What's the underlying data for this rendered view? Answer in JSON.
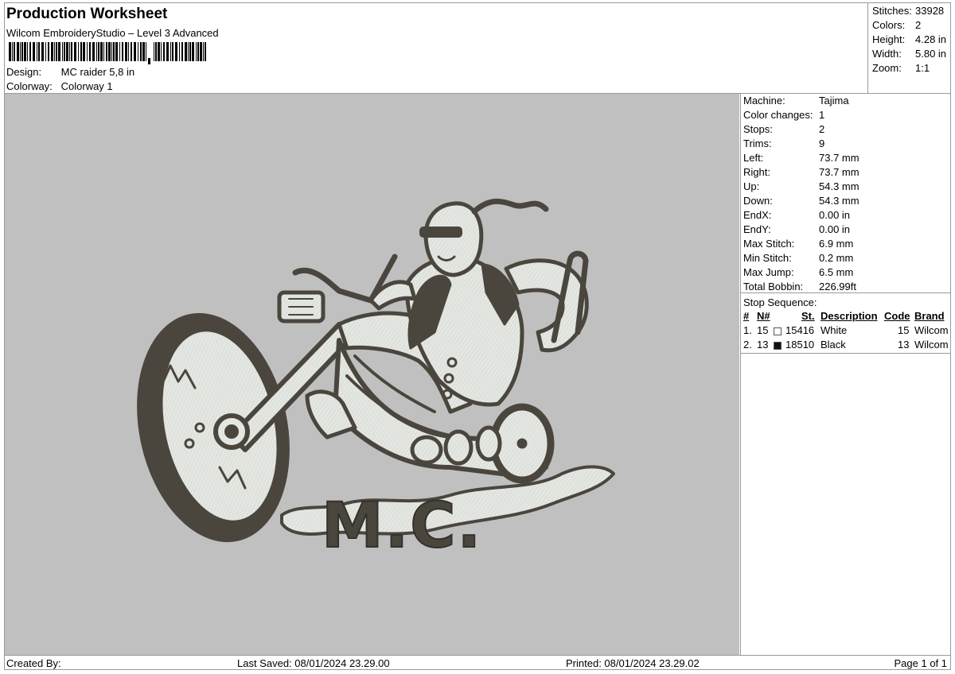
{
  "header": {
    "title": "Production Worksheet",
    "software": "Wilcom EmbroideryStudio – Level 3 Advanced",
    "design_label": "Design:",
    "design_value": "MC raider 5,8 in",
    "colorway_label": "Colorway:",
    "colorway_value": "Colorway 1"
  },
  "summary": [
    {
      "label": "Stitches:",
      "value": "33928"
    },
    {
      "label": "Colors:",
      "value": "2"
    },
    {
      "label": "Height:",
      "value": "4.28 in"
    },
    {
      "label": "Width:",
      "value": "5.80 in"
    },
    {
      "label": "Zoom:",
      "value": "1:1"
    }
  ],
  "machine_info": [
    {
      "label": "Machine:",
      "value": "Tajima"
    },
    {
      "label": "Color changes:",
      "value": "1"
    },
    {
      "label": "Stops:",
      "value": "2"
    },
    {
      "label": "Trims:",
      "value": "9"
    },
    {
      "label": "Left:",
      "value": "73.7 mm"
    },
    {
      "label": "Right:",
      "value": "73.7 mm"
    },
    {
      "label": "Up:",
      "value": "54.3 mm"
    },
    {
      "label": "Down:",
      "value": "54.3 mm"
    },
    {
      "label": "EndX:",
      "value": "0.00 in"
    },
    {
      "label": "EndY:",
      "value": "0.00 in"
    },
    {
      "label": "Max Stitch:",
      "value": "6.9 mm"
    },
    {
      "label": "Min Stitch:",
      "value": "0.2 mm"
    },
    {
      "label": "Max Jump:",
      "value": "6.5 mm"
    },
    {
      "label": "Total Bobbin:",
      "value": "226.99ft"
    }
  ],
  "stop_sequence": {
    "title": "Stop Sequence:",
    "headers": {
      "num": "#",
      "needle": "N#",
      "stitches": "St.",
      "description": "Description",
      "code": "Code",
      "brand": "Brand"
    },
    "rows": [
      {
        "num": "1.",
        "needle": "15",
        "swatch_color": "#ffffff",
        "stitches": "15416",
        "description": "White",
        "code": "15",
        "brand": "Wilcom"
      },
      {
        "num": "2.",
        "needle": "13",
        "swatch_color": "#111111",
        "stitches": "18510",
        "description": "Black",
        "code": "13",
        "brand": "Wilcom"
      }
    ]
  },
  "design_text": "M.C.",
  "colors": {
    "canvas": "#c0c0c0",
    "thread_dark": "#4a463e",
    "thread_light": "#e4e6e2"
  },
  "footer": {
    "created_by": "Created By:",
    "last_saved": "Last Saved: 08/01/2024 23.29.00",
    "printed": "Printed: 08/01/2024 23.29.02",
    "page": "Page 1 of 1"
  }
}
